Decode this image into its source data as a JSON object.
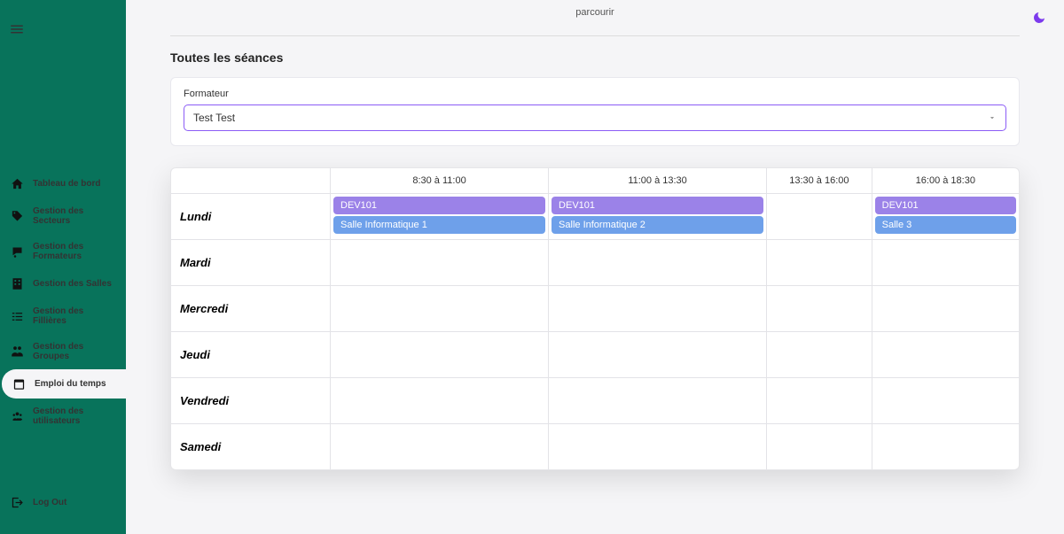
{
  "sidebar": {
    "items": [
      {
        "label": "Tableau de bord",
        "name": "sidebar-item-dashboard"
      },
      {
        "label": "Gestion des Secteurs",
        "name": "sidebar-item-sectors"
      },
      {
        "label": "Gestion des Formateurs",
        "name": "sidebar-item-trainers"
      },
      {
        "label": "Gestion des Salles",
        "name": "sidebar-item-rooms"
      },
      {
        "label": "Gestion des Fillières",
        "name": "sidebar-item-filieres"
      },
      {
        "label": "Gestion des Groupes",
        "name": "sidebar-item-groups"
      },
      {
        "label": "Emploi du temps",
        "name": "sidebar-item-timetable"
      },
      {
        "label": "Gestion des utilisateurs",
        "name": "sidebar-item-users"
      }
    ],
    "logout": "Log Out"
  },
  "top": {
    "parcourir": "parcourir"
  },
  "section": {
    "title": "Toutes les séances",
    "formateur_label": "Formateur",
    "formateur_value": "Test Test"
  },
  "schedule": {
    "time_headers": [
      "8:30 à 11:00",
      "11:00 à 13:30",
      "13:30 à 16:00",
      "16:00 à 18:30"
    ],
    "days": [
      "Lundi",
      "Mardi",
      "Mercredi",
      "Jeudi",
      "Vendredi",
      "Samedi"
    ],
    "sessions": {
      "lundi": [
        {
          "course": "DEV101",
          "room": "Salle Informatique 1"
        },
        {
          "course": "DEV101",
          "room": "Salle Informatique 2"
        },
        null,
        {
          "course": "DEV101",
          "room": "Salle 3"
        }
      ]
    }
  }
}
